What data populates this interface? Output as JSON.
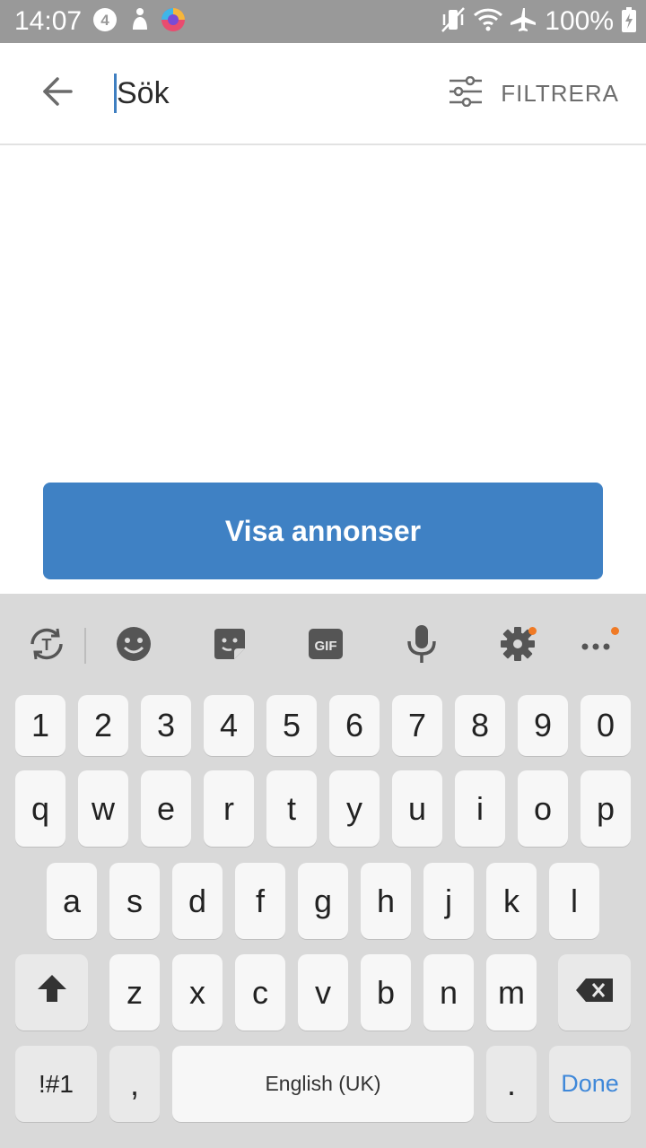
{
  "status_bar": {
    "time": "14:07",
    "battery_percent": "100%",
    "left_icons": [
      "notification-4-icon",
      "figure-icon",
      "browser-app-icon"
    ],
    "right_icons": [
      "vibrate-icon",
      "wifi-icon",
      "airplane-icon",
      "battery-charging-icon"
    ]
  },
  "app_bar": {
    "back_icon": "arrow-left-icon",
    "search_placeholder": "Sök",
    "search_value": "",
    "filter_icon": "sliders-icon",
    "filter_label": "FILTRERA"
  },
  "main": {
    "show_ads_button": "Visa annonser"
  },
  "keyboard": {
    "toolbar": [
      "translate-icon",
      "emoji-icon",
      "sticker-icon",
      "gif-icon",
      "microphone-icon",
      "settings-icon",
      "more-icon"
    ],
    "gif_label": "GIF",
    "row_numbers": [
      "1",
      "2",
      "3",
      "4",
      "5",
      "6",
      "7",
      "8",
      "9",
      "0"
    ],
    "row1": [
      "q",
      "w",
      "e",
      "r",
      "t",
      "y",
      "u",
      "i",
      "o",
      "p"
    ],
    "row2": [
      "a",
      "s",
      "d",
      "f",
      "g",
      "h",
      "j",
      "k",
      "l"
    ],
    "row3": [
      "z",
      "x",
      "c",
      "v",
      "b",
      "n",
      "m"
    ],
    "symbols_label": "!#1",
    "comma_label": ",",
    "space_label": "English (UK)",
    "period_label": ".",
    "done_label": "Done",
    "colors": {
      "accent": "#3f81c4",
      "done_text": "#3f88d9",
      "badge": "#f07a25"
    }
  }
}
